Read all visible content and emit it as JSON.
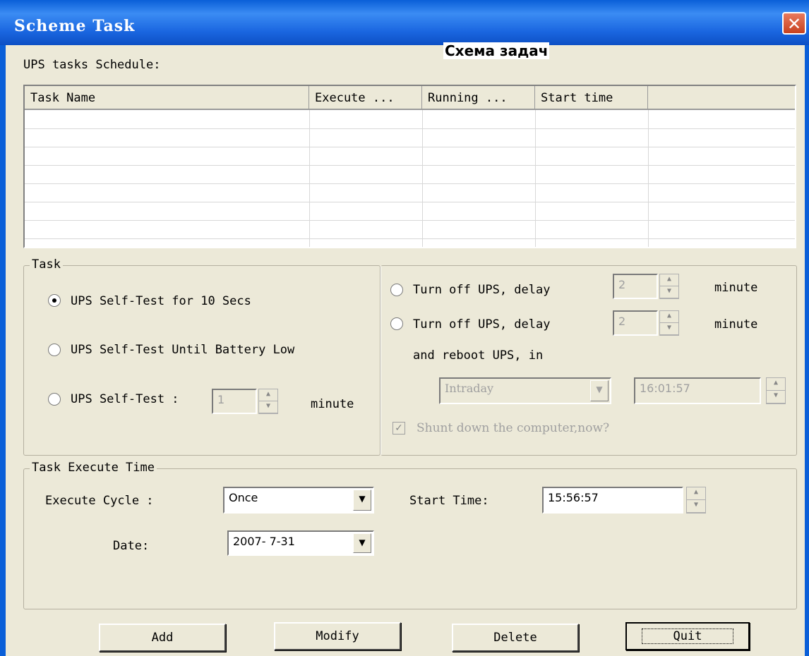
{
  "window": {
    "title": "Scheme Task",
    "close_glyph": "✕",
    "caption_overlay": "Схема задач"
  },
  "schedule": {
    "label": "UPS tasks Schedule:",
    "columns": [
      "Task Name",
      "Execute ...",
      "Running ...",
      "Start time",
      ""
    ],
    "rows": []
  },
  "task": {
    "group_label": "Task",
    "options": {
      "self_test_10": {
        "label": "UPS Self-Test for 10 Secs",
        "selected": true
      },
      "self_test_battery_low": {
        "label": "UPS Self-Test Until Battery Low",
        "selected": false
      },
      "self_test_minutes": {
        "label": "UPS Self-Test :",
        "value": "1",
        "unit": "minute",
        "selected": false
      },
      "turn_off_delay": {
        "label": "Turn off UPS, delay",
        "value": "2",
        "unit": "minute",
        "selected": false
      },
      "turn_off_reboot": {
        "label": "Turn off UPS, delay",
        "value": "2",
        "unit": "minute",
        "reboot_label": "and reboot UPS, in",
        "selected": false
      }
    },
    "reboot_cycle": "Intraday",
    "reboot_time": "16:01:57",
    "shutdown_checkbox": {
      "label": "Shunt down the computer,now?",
      "checked": true,
      "check_glyph": "✓"
    }
  },
  "execute_time": {
    "group_label": "Task Execute Time",
    "cycle_label": "Execute Cycle :",
    "cycle_value": "Once",
    "start_time_label": "Start Time:",
    "start_time_value": "15:56:57",
    "date_label": "Date:",
    "date_value": "2007- 7-31"
  },
  "buttons": {
    "add": "Add",
    "modify": "Modify",
    "delete": "Delete",
    "quit": "Quit"
  },
  "icons": {
    "dropdown": "▼",
    "spin_up": "▲",
    "spin_down": "▼"
  }
}
